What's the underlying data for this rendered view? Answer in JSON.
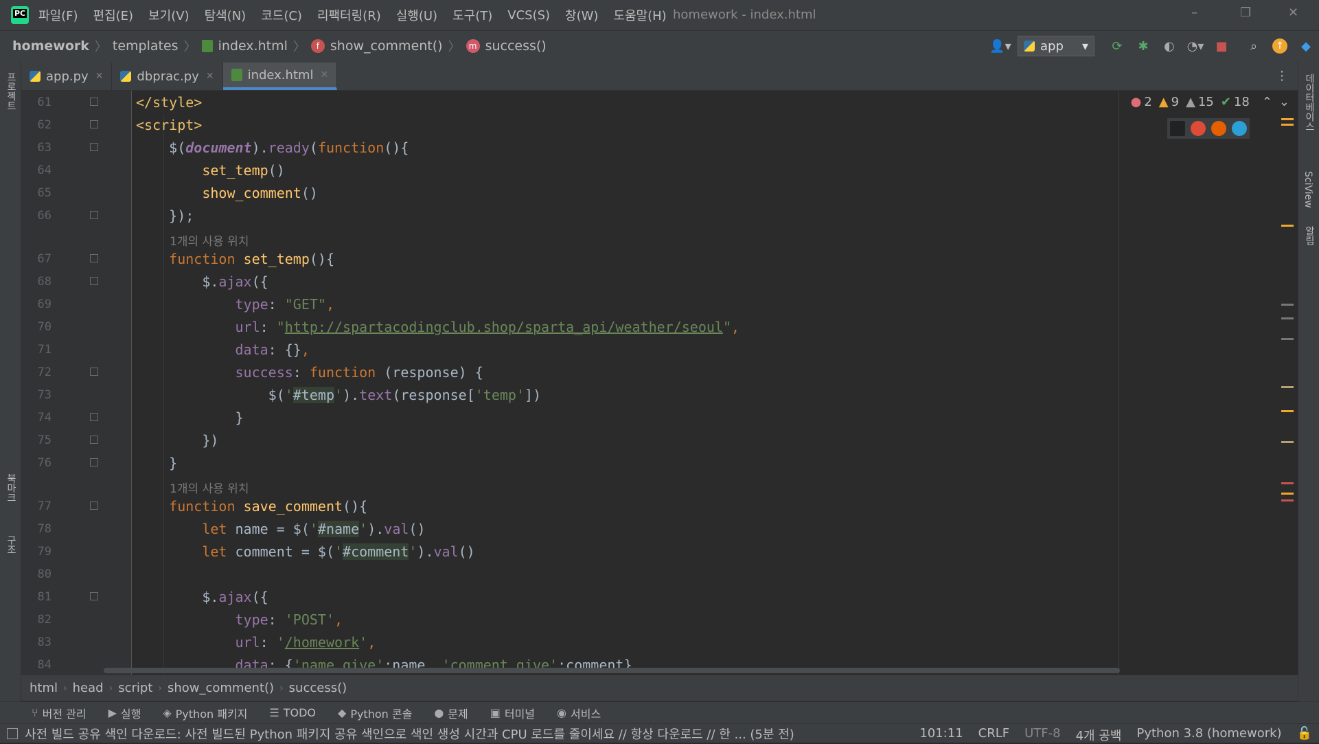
{
  "menu": [
    "파일(F)",
    "편집(E)",
    "보기(V)",
    "탐색(N)",
    "코드(C)",
    "리팩터링(R)",
    "실행(U)",
    "도구(T)",
    "VCS(S)",
    "창(W)",
    "도움말(H)"
  ],
  "window_title": "homework - index.html",
  "window_controls": {
    "minimize": "–",
    "restore": "❐",
    "close": "✕"
  },
  "breadcrumbs": [
    "homework",
    "templates",
    "index.html",
    "show_comment()",
    "success()"
  ],
  "run_config": "app",
  "tabs": [
    {
      "label": "app.py",
      "icon": "python-file-icon",
      "active": false
    },
    {
      "label": "dbprac.py",
      "icon": "python-file-icon",
      "active": false
    },
    {
      "label": "index.html",
      "icon": "html-file-icon",
      "active": true
    }
  ],
  "inspections": {
    "errors": "2",
    "warnings": "9",
    "weak_warnings": "15",
    "typos": "18"
  },
  "left_tool_labels": {
    "project": "프로젝트",
    "bookmarks": "북마크",
    "structure": "구조"
  },
  "right_tool_labels": {
    "database": "데이터베이스",
    "sciview": "SciView",
    "notifications": "알림"
  },
  "usage_hint": "1개의 사용 위치",
  "lines": [
    {
      "n": "61"
    },
    {
      "n": "62"
    },
    {
      "n": "63"
    },
    {
      "n": "64"
    },
    {
      "n": "65"
    },
    {
      "n": "66"
    },
    {
      "n": "67"
    },
    {
      "n": "68"
    },
    {
      "n": "69"
    },
    {
      "n": "70"
    },
    {
      "n": "71"
    },
    {
      "n": "72"
    },
    {
      "n": "73"
    },
    {
      "n": "74"
    },
    {
      "n": "75"
    },
    {
      "n": "76"
    },
    {
      "n": "77"
    },
    {
      "n": "78"
    },
    {
      "n": "79"
    },
    {
      "n": "80"
    },
    {
      "n": "81"
    },
    {
      "n": "82"
    },
    {
      "n": "83"
    },
    {
      "n": "84"
    }
  ],
  "code_breadcrumbs": [
    "html",
    "head",
    "script",
    "show_comment()",
    "success()"
  ],
  "tool_windows": [
    "버전 관리",
    "실행",
    "Python 패키지",
    "TODO",
    "Python 콘솔",
    "문제",
    "터미널",
    "서비스"
  ],
  "status": {
    "message": "사전 빌드 공유 색인 다운로드: 사전 빌드된 Python 패키지 공유 색인으로 색인 생성 시간과 CPU 로드를 줄이세요 // 항상 다운로드 // 한 ... (5분 전)",
    "position": "101:11",
    "line_sep": "CRLF",
    "encoding": "UTF-8",
    "indent": "4개 공백",
    "interpreter": "Python 3.8 (homework)"
  }
}
